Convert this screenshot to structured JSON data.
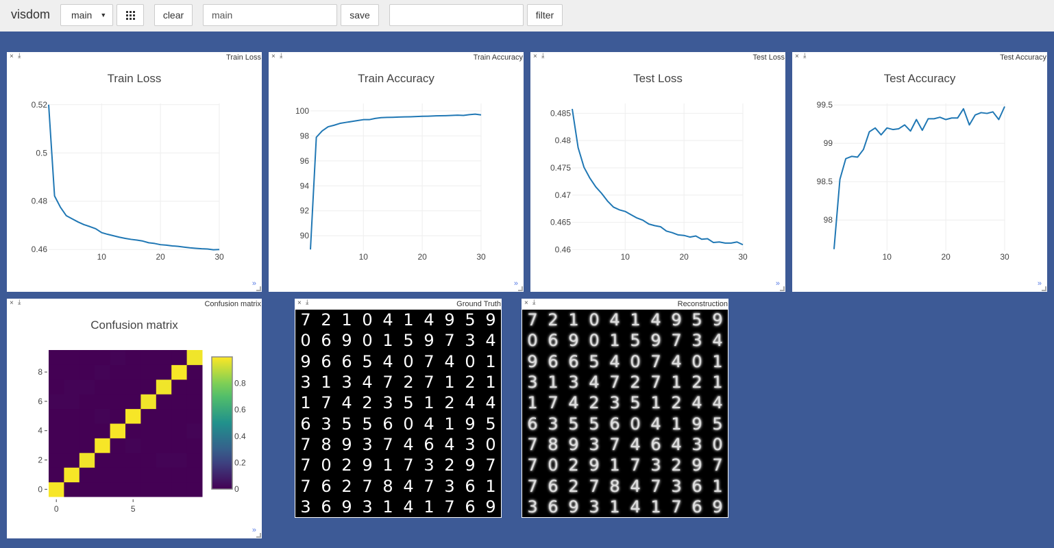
{
  "toolbar": {
    "brand": "visdom",
    "env_select": "main",
    "grid_icon": "grid-icon",
    "clear_label": "clear",
    "env_name_value": "main",
    "save_label": "save",
    "filter_value": "",
    "filter_label": "filter"
  },
  "panel_controls": {
    "close": "×",
    "download": "⤓",
    "more": "»"
  },
  "colors": {
    "background": "#3d5a96",
    "line": "#1f77b4",
    "viridis_low": "#440154",
    "viridis_high": "#fde725"
  },
  "chart_data": [
    {
      "id": "train-loss",
      "type": "line",
      "window_title": "Train Loss",
      "title": "Train Loss",
      "xlabel": "",
      "ylabel": "",
      "xlim": [
        1,
        30
      ],
      "ylim": [
        0.4595,
        0.5205
      ],
      "xticks": [
        10,
        20,
        30
      ],
      "yticks": [
        0.46,
        0.48,
        0.5,
        0.52
      ],
      "ytick_labels": [
        "0.46",
        "0.48",
        "0.5",
        "0.52"
      ],
      "grid": true,
      "x": [
        1,
        2,
        3,
        4,
        5,
        6,
        7,
        8,
        9,
        10,
        11,
        12,
        13,
        14,
        15,
        16,
        17,
        18,
        19,
        20,
        21,
        22,
        23,
        24,
        25,
        26,
        27,
        28,
        29,
        30
      ],
      "series": [
        {
          "name": "Train Loss",
          "values": [
            0.52,
            0.4822,
            0.4775,
            0.474,
            0.4727,
            0.4714,
            0.4703,
            0.4695,
            0.4686,
            0.467,
            0.4663,
            0.4657,
            0.4651,
            0.4646,
            0.4642,
            0.4639,
            0.4635,
            0.4628,
            0.4625,
            0.462,
            0.4618,
            0.4615,
            0.4613,
            0.461,
            0.4607,
            0.4605,
            0.4603,
            0.4602,
            0.4599,
            0.46
          ]
        }
      ]
    },
    {
      "id": "train-accuracy",
      "type": "line",
      "window_title": "Train Accuracy",
      "title": "Train Accuracy",
      "xlabel": "",
      "ylabel": "",
      "xlim": [
        1,
        30
      ],
      "ylim": [
        88.8,
        100.6
      ],
      "xticks": [
        10,
        20,
        30
      ],
      "yticks": [
        90,
        92,
        94,
        96,
        98,
        100
      ],
      "ytick_labels": [
        "90",
        "92",
        "94",
        "96",
        "98",
        "100"
      ],
      "grid": true,
      "x": [
        1,
        2,
        3,
        4,
        5,
        6,
        7,
        8,
        9,
        10,
        11,
        12,
        13,
        14,
        15,
        16,
        17,
        18,
        19,
        20,
        21,
        22,
        23,
        24,
        25,
        26,
        27,
        28,
        29,
        30
      ],
      "series": [
        {
          "name": "Train Accuracy",
          "values": [
            88.9,
            97.89,
            98.4,
            98.73,
            98.85,
            99.0,
            99.08,
            99.15,
            99.23,
            99.3,
            99.3,
            99.4,
            99.46,
            99.48,
            99.49,
            99.51,
            99.52,
            99.53,
            99.55,
            99.57,
            99.58,
            99.6,
            99.61,
            99.62,
            99.64,
            99.66,
            99.64,
            99.7,
            99.74,
            99.68
          ]
        }
      ]
    },
    {
      "id": "test-loss",
      "type": "line",
      "window_title": "Test Loss",
      "title": "Test Loss",
      "xlabel": "",
      "ylabel": "",
      "xlim": [
        1,
        30
      ],
      "ylim": [
        0.4598,
        0.4868
      ],
      "xticks": [
        10,
        20,
        30
      ],
      "yticks": [
        0.46,
        0.465,
        0.47,
        0.475,
        0.48,
        0.485
      ],
      "ytick_labels": [
        "0.46",
        "0.465",
        "0.47",
        "0.475",
        "0.48",
        "0.485"
      ],
      "grid": true,
      "x": [
        1,
        2,
        3,
        4,
        5,
        6,
        7,
        8,
        9,
        10,
        11,
        12,
        13,
        14,
        15,
        16,
        17,
        18,
        19,
        20,
        21,
        22,
        23,
        24,
        25,
        26,
        27,
        28,
        29,
        30
      ],
      "series": [
        {
          "name": "Test Loss",
          "values": [
            0.4858,
            0.4787,
            0.4751,
            0.4731,
            0.4715,
            0.4703,
            0.4689,
            0.4678,
            0.4673,
            0.467,
            0.4664,
            0.4658,
            0.4654,
            0.4647,
            0.4644,
            0.4642,
            0.4634,
            0.4631,
            0.4627,
            0.4626,
            0.4623,
            0.4625,
            0.4619,
            0.462,
            0.4613,
            0.4614,
            0.4612,
            0.4612,
            0.4614,
            0.4609
          ]
        }
      ]
    },
    {
      "id": "test-accuracy",
      "type": "line",
      "window_title": "Test Accuracy",
      "title": "Test Accuracy",
      "xlabel": "",
      "ylabel": "",
      "xlim": [
        1,
        30
      ],
      "ylim": [
        97.6,
        99.52
      ],
      "xticks": [
        10,
        20,
        30
      ],
      "yticks": [
        98,
        98.5,
        99,
        99.5
      ],
      "ytick_labels": [
        "98",
        "98.5",
        "99",
        "99.5"
      ],
      "grid": true,
      "x": [
        1,
        2,
        3,
        4,
        5,
        6,
        7,
        8,
        9,
        10,
        11,
        12,
        13,
        14,
        15,
        16,
        17,
        18,
        19,
        20,
        21,
        22,
        23,
        24,
        25,
        26,
        27,
        28,
        29,
        30
      ],
      "series": [
        {
          "name": "Test Accuracy",
          "values": [
            97.62,
            98.53,
            98.8,
            98.83,
            98.82,
            98.92,
            99.15,
            99.2,
            99.11,
            99.2,
            99.18,
            99.19,
            99.24,
            99.16,
            99.31,
            99.17,
            99.32,
            99.32,
            99.34,
            99.31,
            99.33,
            99.33,
            99.45,
            99.24,
            99.37,
            99.4,
            99.39,
            99.41,
            99.31,
            99.48
          ]
        }
      ]
    },
    {
      "id": "confusion-matrix",
      "type": "heatmap",
      "window_title": "Confusion matrix",
      "title": "Confusion matrix",
      "xticks": [
        0,
        5
      ],
      "xtick_labels": [
        "0",
        "5"
      ],
      "yticks": [
        0,
        2,
        4,
        6,
        8
      ],
      "ytick_labels": [
        "0",
        "2",
        "4",
        "6",
        "8"
      ],
      "colorbar": {
        "range": [
          0,
          1
        ],
        "ticks": [
          0,
          0.2,
          0.4,
          0.6,
          0.8
        ],
        "tick_labels": [
          "0",
          "0.2",
          "0.4",
          "0.6",
          "0.8"
        ],
        "colorscale": "Viridis"
      },
      "rows_bottom_to_top": [
        [
          0.99,
          0,
          0,
          0,
          0,
          0,
          0,
          0,
          0,
          0
        ],
        [
          0,
          0.99,
          0,
          0,
          0,
          0,
          0,
          0,
          0,
          0
        ],
        [
          0,
          0,
          0.98,
          0,
          0,
          0,
          0,
          0.01,
          0.01,
          0
        ],
        [
          0,
          0,
          0,
          0.99,
          0,
          0.01,
          0,
          0,
          0,
          0
        ],
        [
          0,
          0,
          0,
          0,
          0.99,
          0,
          0,
          0,
          0,
          0.01
        ],
        [
          0,
          0,
          0,
          0.01,
          0,
          0.99,
          0,
          0,
          0,
          0
        ],
        [
          0.01,
          0.01,
          0,
          0,
          0,
          0,
          0.98,
          0,
          0,
          0
        ],
        [
          0,
          0.01,
          0.01,
          0,
          0,
          0,
          0,
          0.98,
          0,
          0
        ],
        [
          0,
          0,
          0,
          0.01,
          0,
          0,
          0,
          0,
          0.99,
          0
        ],
        [
          0,
          0,
          0,
          0,
          0.01,
          0,
          0,
          0,
          0,
          0.98
        ]
      ]
    }
  ],
  "images": {
    "ground_truth": {
      "window_title": "Ground Truth",
      "digits": [
        [
          7,
          2,
          1,
          0,
          4,
          1,
          4,
          9,
          5,
          9
        ],
        [
          0,
          6,
          9,
          0,
          1,
          5,
          9,
          7,
          3,
          4
        ],
        [
          9,
          6,
          6,
          5,
          4,
          0,
          7,
          4,
          0,
          1
        ],
        [
          3,
          1,
          3,
          4,
          7,
          2,
          7,
          1,
          2,
          1
        ],
        [
          1,
          7,
          4,
          2,
          3,
          5,
          1,
          2,
          4,
          4
        ],
        [
          6,
          3,
          5,
          5,
          6,
          0,
          4,
          1,
          9,
          5
        ],
        [
          7,
          8,
          9,
          3,
          7,
          4,
          6,
          4,
          3,
          0
        ],
        [
          7,
          0,
          2,
          9,
          1,
          7,
          3,
          2,
          9,
          7
        ],
        [
          7,
          6,
          2,
          7,
          8,
          4,
          7,
          3,
          6,
          1
        ],
        [
          3,
          6,
          9,
          3,
          1,
          4,
          1,
          7,
          6,
          9
        ]
      ]
    },
    "reconstruction": {
      "window_title": "Reconstruction",
      "digits": [
        [
          7,
          2,
          1,
          0,
          4,
          1,
          4,
          9,
          5,
          9
        ],
        [
          0,
          6,
          9,
          0,
          1,
          5,
          9,
          7,
          3,
          4
        ],
        [
          9,
          6,
          6,
          5,
          4,
          0,
          7,
          4,
          0,
          1
        ],
        [
          3,
          1,
          3,
          4,
          7,
          2,
          7,
          1,
          2,
          1
        ],
        [
          1,
          7,
          4,
          2,
          3,
          5,
          1,
          2,
          4,
          4
        ],
        [
          6,
          3,
          5,
          5,
          6,
          0,
          4,
          1,
          9,
          5
        ],
        [
          7,
          8,
          9,
          3,
          7,
          4,
          6,
          4,
          3,
          0
        ],
        [
          7,
          0,
          2,
          9,
          1,
          7,
          3,
          2,
          9,
          7
        ],
        [
          7,
          6,
          2,
          7,
          8,
          4,
          7,
          3,
          6,
          1
        ],
        [
          3,
          6,
          9,
          3,
          1,
          4,
          1,
          7,
          6,
          9
        ]
      ]
    }
  }
}
